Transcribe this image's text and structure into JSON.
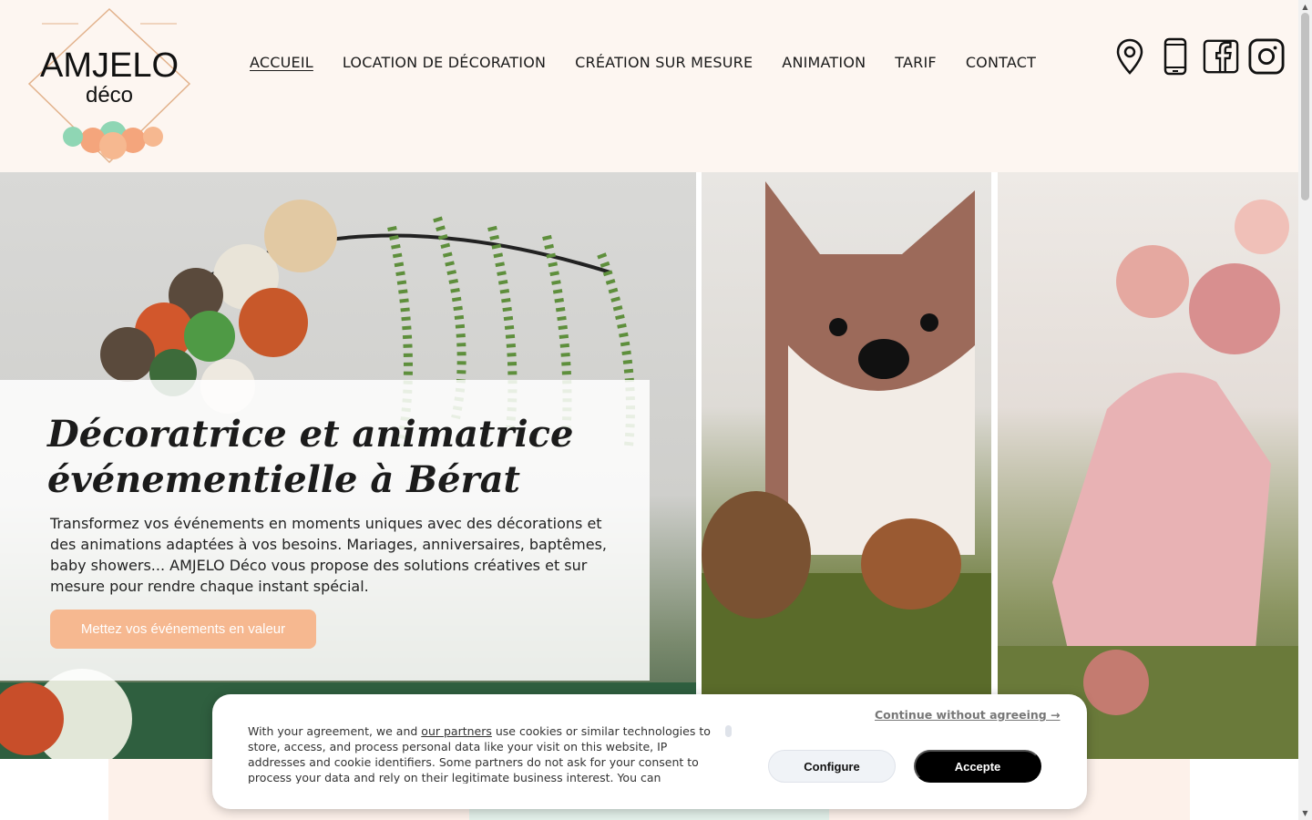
{
  "header": {
    "logo_main": "AMJELO",
    "logo_sub": "déco",
    "nav": [
      {
        "label": "ACCUEIL",
        "active": true
      },
      {
        "label": "LOCATION DE DÉCORATION",
        "active": false
      },
      {
        "label": "CRÉATION SUR MESURE",
        "active": false
      },
      {
        "label": "ANIMATION",
        "active": false
      },
      {
        "label": "TARIF",
        "active": false
      },
      {
        "label": "CONTACT",
        "active": false
      }
    ],
    "social_icons": [
      "location-pin-icon",
      "phone-icon",
      "facebook-icon",
      "instagram-icon"
    ]
  },
  "hero": {
    "title": "Décoratrice et animatrice événementielle à Bérat",
    "text": "Transformez vos événements en moments uniques avec des décorations et des animations adaptées à vos besoins. Mariages, anniversaires, baptêmes, baby showers... AMJELO Déco vous propose des solutions créatives et sur mesure pour rendre chaque instant spécial.",
    "cta": "Mettez vos événements en valeur"
  },
  "cookie": {
    "text_before": "With your agreement, we and ",
    "partners_link": "our partners",
    "text_after": " use cookies or similar technologies to store, access, and process personal data like your visit on this website, IP addresses and cookie identifiers. Some partners do not ask for your consent to process your data and rely on their legitimate business interest. You can",
    "continue": "Continue without agreeing →",
    "configure": "Configure",
    "accept": "Accepte"
  },
  "colors": {
    "header_bg": "#fdf6f1",
    "accent": "#f6b890",
    "band_left": "#fdf1ea",
    "band_mid": "#e3f1ea",
    "band_right": "#fdf1ea"
  }
}
